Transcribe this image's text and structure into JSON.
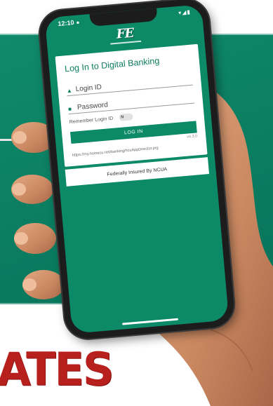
{
  "status": {
    "time": "12:10",
    "icons": "▾◢▮"
  },
  "logo": {
    "mark": "FE"
  },
  "login": {
    "title": "Log In to Digital Banking",
    "login_id_label": "Login ID",
    "password_label": "Password",
    "remember_label": "Remember Login ID",
    "toggle_text": "N",
    "button_label": "LOG IN",
    "version": "v4.3.0",
    "url": "https://my.homecu.net/banking/hcuAppDirector.prg"
  },
  "footer": {
    "insured_text": "Federally Insured By NCUA"
  },
  "poster": {
    "red_word": "ATES"
  },
  "colors": {
    "brand_green": "#0c8a68",
    "poster_red": "#b8201e"
  }
}
